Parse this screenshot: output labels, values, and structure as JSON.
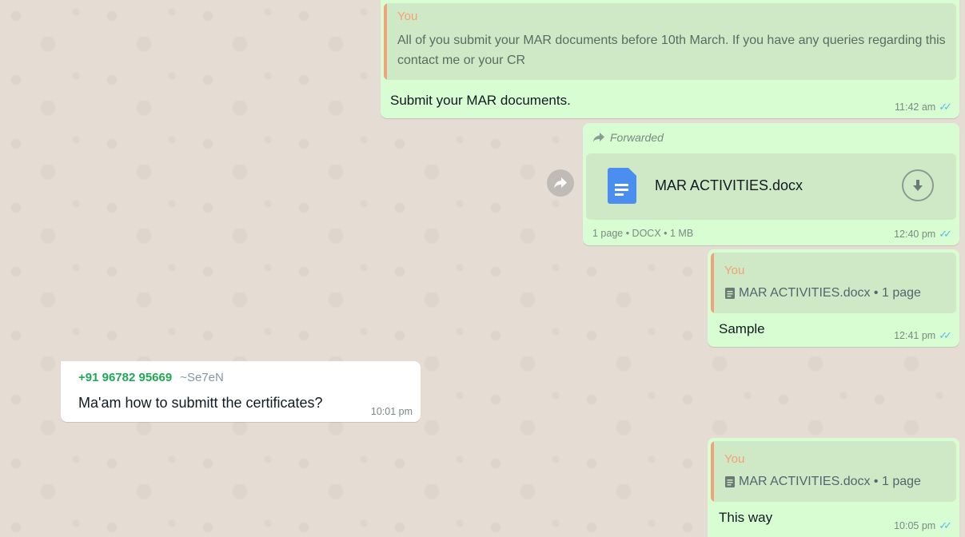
{
  "messages": [
    {
      "quote_author": "You",
      "quote_text": "All of you submit your MAR documents before 10th March. If you have any queries regarding this contact me or your CR",
      "text": "Submit your MAR documents.",
      "time": "11:42 am"
    },
    {
      "forwarded_label": "Forwarded",
      "file_name": "MAR ACTIVITIES.docx",
      "file_meta": "1 page • DOCX • 1 MB",
      "time": "12:40 pm"
    },
    {
      "quote_author": "You",
      "quote_doc": "MAR ACTIVITIES.docx • 1 page",
      "text": "Sample",
      "time": "12:41 pm"
    },
    {
      "sender_phone": "+91 96782 95669",
      "sender_name": "~Se7eN",
      "text": "Ma'am how to submitt the certificates?",
      "time": "10:01 pm"
    },
    {
      "quote_author": "You",
      "quote_doc": "MAR ACTIVITIES.docx • 1 page",
      "text": "This way",
      "time": "10:05 pm"
    }
  ],
  "colors": {
    "outgoing_bubble": "#d9fdd3",
    "incoming_bubble": "#ffffff",
    "quote_accent": "#f0a27a",
    "sender_phone": "#1fa855",
    "read_ticks": "#53bdeb"
  },
  "icons": [
    "forward-arrow-icon",
    "document-icon",
    "download-icon",
    "read-receipt-icon",
    "forward-button-icon"
  ]
}
